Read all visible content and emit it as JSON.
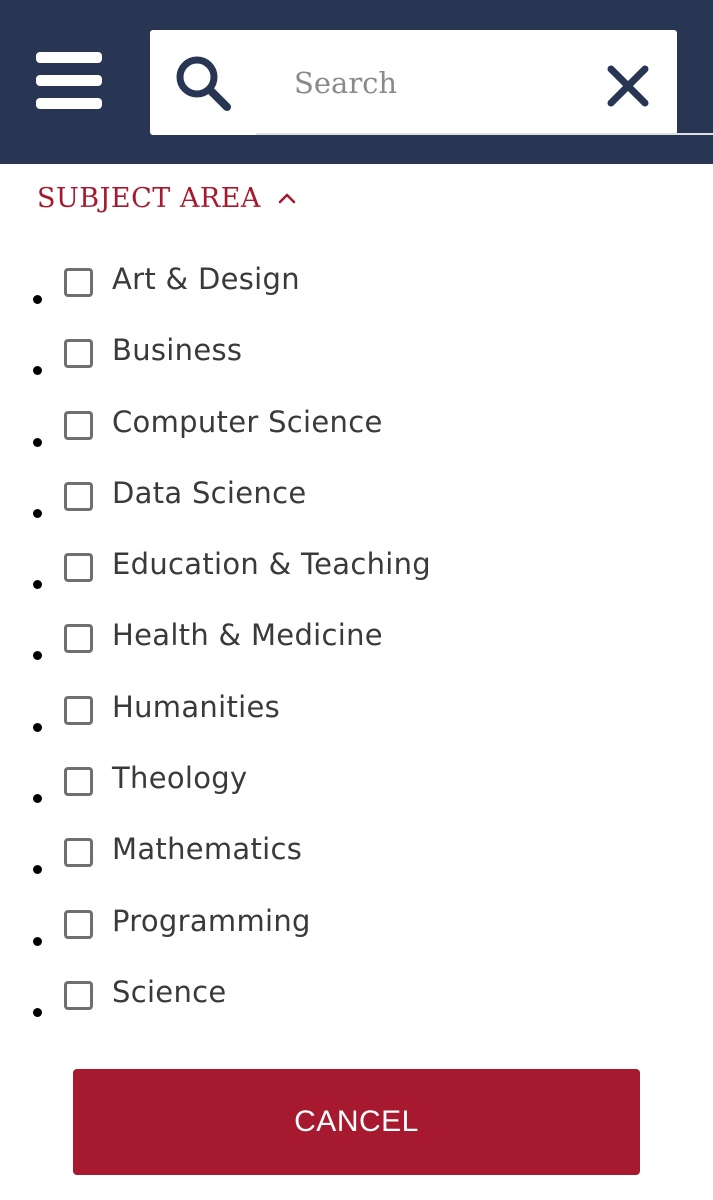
{
  "header": {
    "menu_icon": "hamburger-menu-icon",
    "search": {
      "placeholder": "Search",
      "value": "",
      "search_icon": "search-icon",
      "clear_icon": "close-icon"
    }
  },
  "filter": {
    "title": "SUBJECT AREA",
    "toggle_icon": "chevron-up-icon",
    "items": [
      {
        "label": "Art & Design",
        "checked": false
      },
      {
        "label": "Business",
        "checked": false
      },
      {
        "label": "Computer Science",
        "checked": false
      },
      {
        "label": "Data Science",
        "checked": false
      },
      {
        "label": "Education & Teaching",
        "checked": false
      },
      {
        "label": "Health & Medicine",
        "checked": false
      },
      {
        "label": "Humanities",
        "checked": false
      },
      {
        "label": "Theology",
        "checked": false
      },
      {
        "label": "Mathematics",
        "checked": false
      },
      {
        "label": "Programming",
        "checked": false
      },
      {
        "label": "Science",
        "checked": false
      }
    ]
  },
  "actions": {
    "cancel_label": "CANCEL"
  },
  "colors": {
    "header_bg": "#283654",
    "accent": "#a6192e",
    "icon": "#283654"
  }
}
